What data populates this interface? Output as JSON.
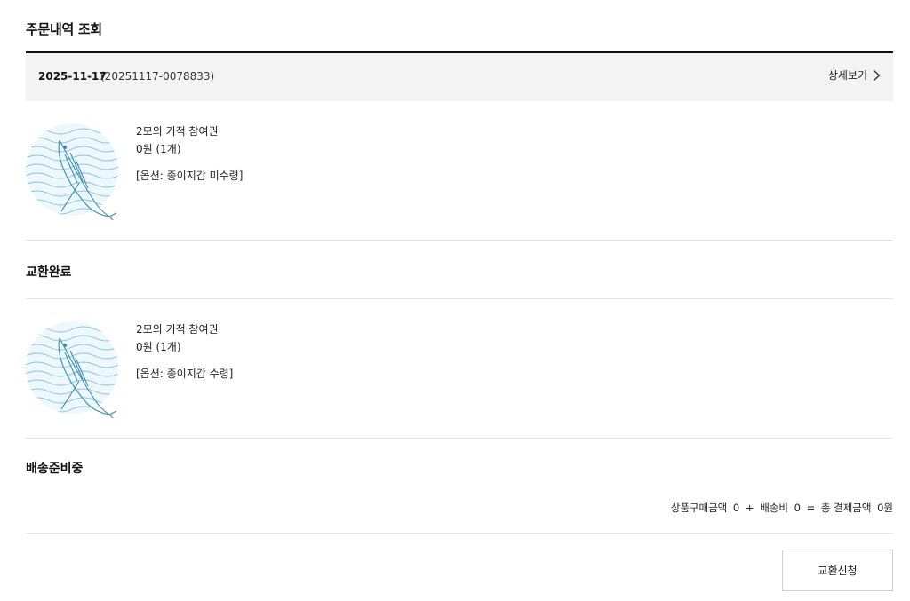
{
  "page": {
    "title": "주문내역 조회"
  },
  "order": {
    "date": "2025-11-17",
    "number": "(20251117-0078833)",
    "detail_label": "상세보기"
  },
  "items": [
    {
      "name": "2모의 기적 참여권",
      "price": "0원 (1개)",
      "option": "[옵션: 종이지갑 미수령]"
    },
    {
      "name": "2모의 기적 참여권",
      "price": "0원 (1개)",
      "option": "[옵션: 종이지갑 수령]"
    }
  ],
  "statuses": [
    "교환완료",
    "배송준비중"
  ],
  "summary": {
    "product_label": "상품구매금액",
    "product_amount": "0",
    "plus": "+",
    "shipping_label": "배송비",
    "shipping_amount": "0",
    "equals": "=",
    "total_label": "총 결제금액",
    "total_amount": "0원"
  },
  "actions": {
    "exchange_label": "교환신청"
  },
  "icons": {
    "detail_arrow": "chevron-right-icon",
    "thumbnail": "whale-illustration"
  },
  "colors": {
    "header_bg": "#f3f3f3",
    "rule": "#e3e3e3",
    "accent_blue": "#4aa3c8"
  }
}
